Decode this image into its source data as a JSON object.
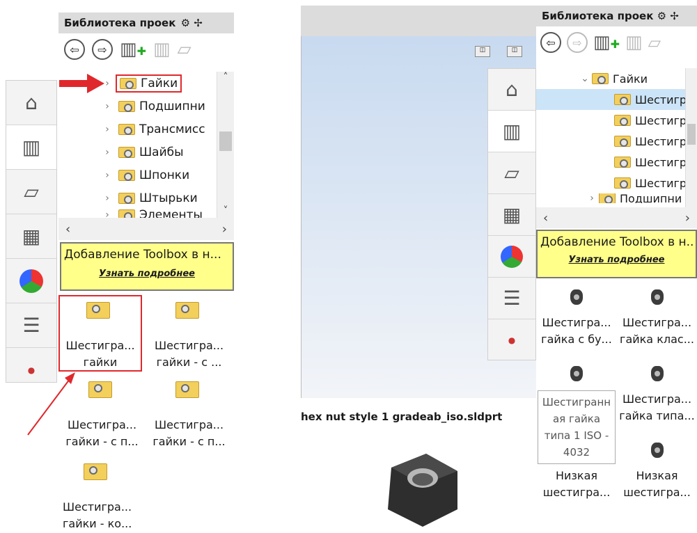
{
  "left": {
    "title": "Библиотека проек",
    "tree": [
      "Гайки",
      "Подшипни",
      "Трансмисс",
      "Шайбы",
      "Шпонки",
      "Штырьки",
      "Элементы"
    ],
    "banner": {
      "text": "Добавление Toolbox в н...",
      "link": "Узнать подробнее"
    },
    "items": [
      {
        "l1": "Шестигра...",
        "l2": "гайки"
      },
      {
        "l1": "Шестигра...",
        "l2": "гайки - с ..."
      },
      {
        "l1": "Шестигра...",
        "l2": "гайки - с п..."
      },
      {
        "l1": "Шестигра...",
        "l2": "гайки - с п..."
      },
      {
        "l1": "Шестигра...",
        "l2": "гайки - ко..."
      }
    ]
  },
  "right": {
    "title": "Библиотека проек",
    "tree_parent": "Гайки",
    "tree_children": [
      "Шестигр",
      "Шестигр",
      "Шестигр",
      "Шестигр",
      "Шестигр"
    ],
    "tree_next": "Подшипни",
    "banner": {
      "text": "Добавление Toolbox в н...",
      "link": "Узнать подробнее"
    },
    "items": [
      {
        "l1": "Шестигра...",
        "l2": "гайка с бу..."
      },
      {
        "l1": "Шестигра...",
        "l2": "гайка клас..."
      },
      {
        "l1": "Шестигра...",
        "l2": "гайка типа..."
      },
      {
        "l1": "Низкая",
        "l2": "шестигра..."
      },
      {
        "l1": "Низкая",
        "l2": "шестигра..."
      }
    ],
    "tooltip": [
      "Шестигранн",
      "ая гайка",
      "типа 1 ISO -",
      "4032"
    ],
    "preview_filename": "hex nut style 1 gradeab_iso.sldprt"
  },
  "colors": {
    "banner": "#ffff8a",
    "accent_red": "#e0282c",
    "selection": "#cce4f7"
  }
}
